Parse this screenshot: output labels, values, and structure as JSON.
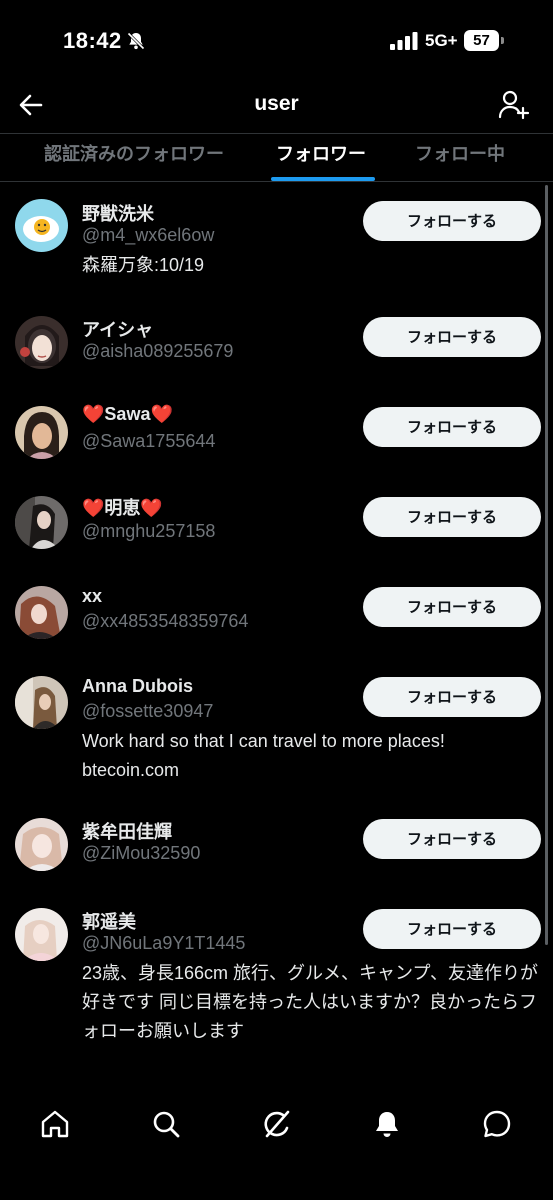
{
  "status_bar": {
    "time": "18:42",
    "network": "5G+",
    "battery": "57"
  },
  "header": {
    "title": "user"
  },
  "tabs": [
    {
      "label": "認証済みのフォロワー",
      "active": false
    },
    {
      "label": "フォロワー",
      "active": true
    },
    {
      "label": "フォロー中",
      "active": false
    }
  ],
  "follow_label": "フォローする",
  "followers": [
    {
      "name": "野獣洗米",
      "handle": "@m4_wx6el6ow",
      "bio": "森羅万象:10/19"
    },
    {
      "name": "アイシャ",
      "handle": "@aisha089255679",
      "bio": ""
    },
    {
      "name_prefix": "❤️",
      "name": "Sawa",
      "name_suffix": "❤️",
      "handle": "@Sawa1755644",
      "bio": ""
    },
    {
      "name_prefix": "❤️",
      "name": "明恵",
      "name_suffix": "❤️",
      "handle": "@mnghu257158",
      "bio": ""
    },
    {
      "name": "xx",
      "handle": "@xx4853548359764",
      "bio": ""
    },
    {
      "name": "Anna Dubois",
      "handle": "@fossette30947",
      "bio": "Work hard so that I can travel to more places! btecoin.com"
    },
    {
      "name": "紫牟田佳輝",
      "handle": "@ZiMou32590",
      "bio": ""
    },
    {
      "name": "郭遥美",
      "handle": "@JN6uLa9Y1T1445",
      "bio": "23歳、身長166cm 旅行、グルメ、キャンプ、友達作りが好きです 同じ目標を持った人はいますか？良かったらフォローお願いします"
    }
  ],
  "colors": {
    "background": "#000000",
    "accent": "#1d9bf0",
    "secondary_text": "#71767b",
    "follow_button_bg": "#eff3f4"
  },
  "bottom_nav": {
    "items": [
      "home-icon",
      "search-icon",
      "grok-icon",
      "notifications-icon",
      "messages-icon"
    ]
  }
}
